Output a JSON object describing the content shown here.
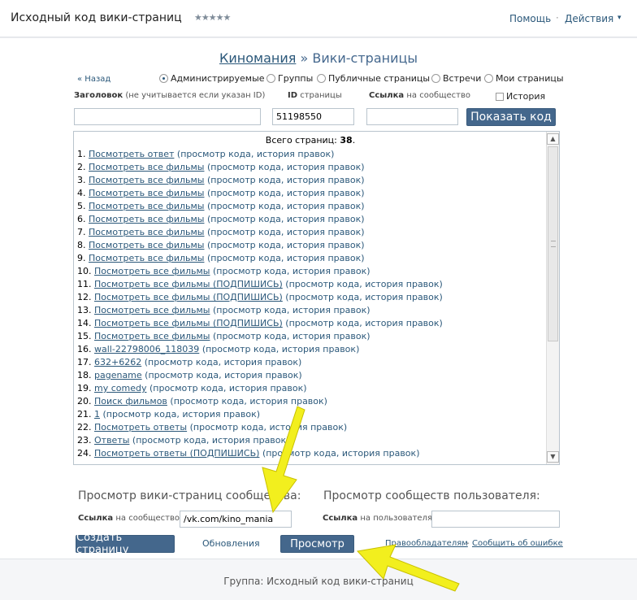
{
  "header": {
    "app_title": "Исходный код вики-страниц",
    "stars": "★★★★★",
    "help": "Помощь",
    "separator": "·",
    "actions": "Действия",
    "actions_caret": "▾"
  },
  "heading": {
    "community": "Киномания",
    "separator": "»",
    "section": "Вики-страницы"
  },
  "filters": {
    "back": "« Назад",
    "options": [
      "Администрируемые",
      "Группы",
      "Публичные страницы",
      "Встречи",
      "Мои страницы"
    ],
    "selected_index": 0
  },
  "form": {
    "title_label_bold": "Заголовок",
    "title_label_note": "(не учитывается если указан ID)",
    "id_label_bold": "ID",
    "id_label_note": "страницы",
    "link_label_bold": "Ссылка",
    "link_label_note": "на сообщество",
    "history_label": "История",
    "title_value": "",
    "id_value": "51198550",
    "link_value": "",
    "show_code_button": "Показать код"
  },
  "list": {
    "total_label": "Всего страниц:",
    "total_value": "38",
    "total_suffix": ".",
    "meta_open": "(",
    "view_code": "просмотр кода",
    "comma": ", ",
    "history": "история правок",
    "meta_close": ")",
    "items": [
      {
        "n": "1.",
        "title": "Посмотреть ответ"
      },
      {
        "n": "2.",
        "title": "Посмотреть все фильмы"
      },
      {
        "n": "3.",
        "title": "Посмотреть все фильмы"
      },
      {
        "n": "4.",
        "title": "Посмотреть все фильмы"
      },
      {
        "n": "5.",
        "title": "Посмотреть все фильмы"
      },
      {
        "n": "6.",
        "title": "Посмотреть все фильмы"
      },
      {
        "n": "7.",
        "title": "Посмотреть все фильмы"
      },
      {
        "n": "8.",
        "title": "Посмотреть все фильмы"
      },
      {
        "n": "9.",
        "title": "Посмотреть все фильмы"
      },
      {
        "n": "10.",
        "title": "Посмотреть все фильмы"
      },
      {
        "n": "11.",
        "title": "Посмотреть все фильмы (ПОДПИШИСЬ)"
      },
      {
        "n": "12.",
        "title": "Посмотреть все фильмы (ПОДПИШИСЬ)"
      },
      {
        "n": "13.",
        "title": "Посмотреть все фильмы"
      },
      {
        "n": "14.",
        "title": "Посмотреть все фильмы (ПОДПИШИСЬ)"
      },
      {
        "n": "15.",
        "title": "Посмотреть все фильмы"
      },
      {
        "n": "16.",
        "title": "wall-22798006_118039"
      },
      {
        "n": "17.",
        "title": "632+6262"
      },
      {
        "n": "18.",
        "title": "pagename"
      },
      {
        "n": "19.",
        "title": "my comedy"
      },
      {
        "n": "20.",
        "title": "Поиск фильмов"
      },
      {
        "n": "21.",
        "title": "1"
      },
      {
        "n": "22.",
        "title": "Посмотреть ответы"
      },
      {
        "n": "23.",
        "title": "Ответы"
      },
      {
        "n": "24.",
        "title": "Посмотреть ответы (ПОДПИШИСЬ)"
      }
    ]
  },
  "bottom": {
    "community_section": "Просмотр вики-страниц сообщества:",
    "user_section": "Просмотр сообществ пользователя:",
    "community_link_bold": "Ссылка",
    "community_link_note": "на сообщество",
    "community_link_value": "/vk.com/kino_mania",
    "user_link_bold": "Ссылка",
    "user_link_note": "на пользователя",
    "user_link_value": "",
    "create_page_button": "Создать страницу",
    "updates_link": "Обновления",
    "view_button": "Просмотр",
    "copyright_link": "Правообладателям",
    "dash": "-",
    "report_link": "Сообщить об ошибке"
  },
  "footer": {
    "text": "Группа: Исходный код вики-страниц"
  },
  "colors": {
    "accent": "#44678c",
    "link": "#2b587a",
    "arrow": "#f2ef1e"
  }
}
